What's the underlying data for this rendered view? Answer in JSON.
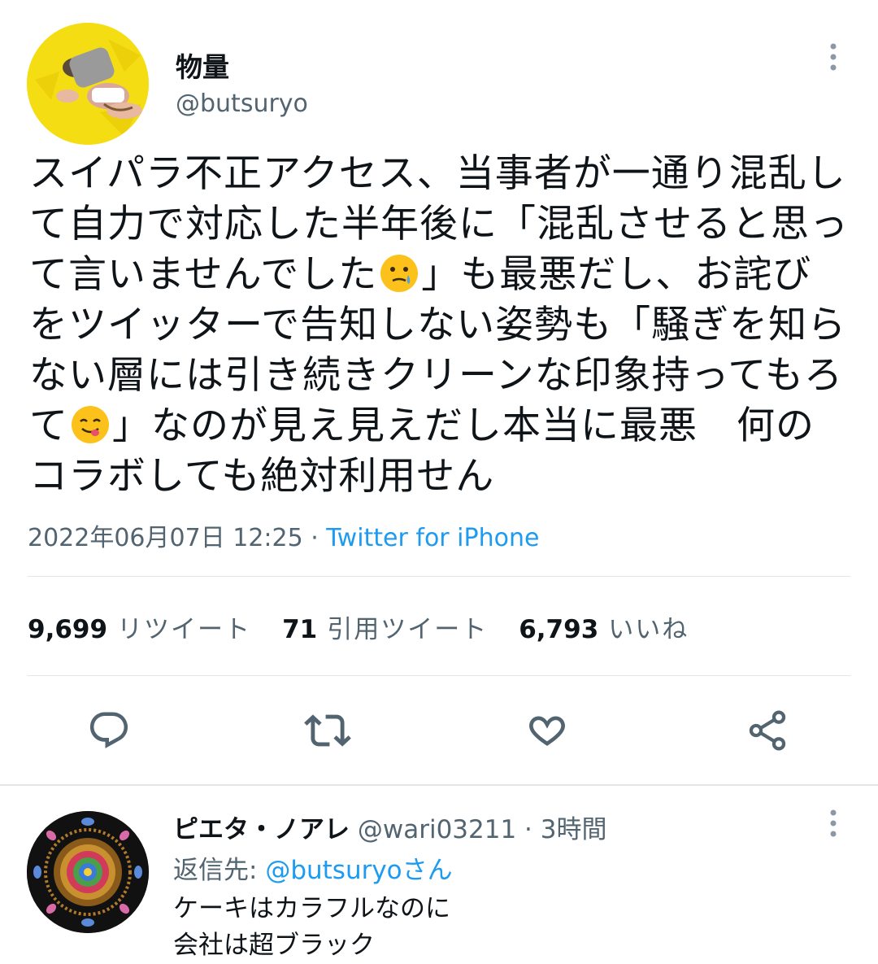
{
  "tweet": {
    "author_name": "物量",
    "author_handle": "@butsuryo",
    "text_part1": "スイパラ不正アクセス、当事者が一通り混乱して自力で対応した半年後に「混乱させると思って言いませんでした",
    "text_part2": "」も最悪だし、お詫びをツイッターで告知しない姿勢も「騒ぎを知らない層には引き続きクリーンな印象持ってもろて",
    "text_part3": "」なのが見え見えだし本当に最悪　何のコラボしても絶対利用せん",
    "emoji1": "face-holding-back-tears-icon",
    "emoji2": "face-savoring-food-icon",
    "timestamp": "2022年06月07日 12:25 · ",
    "source": "Twitter for iPhone"
  },
  "stats": {
    "retweets_count": "9,699",
    "retweets_label": "リツイート",
    "quotes_count": "71",
    "quotes_label": "引用ツイート",
    "likes_count": "6,793",
    "likes_label": "いいね"
  },
  "actions": [
    "reply-icon",
    "retweet-icon",
    "like-icon",
    "share-icon"
  ],
  "reply": {
    "author_name": "ピエタ・ノアレ",
    "author_handle": "@wari03211",
    "time": " · 3時間",
    "replying_prefix": "返信先: ",
    "replying_mention": "@butsuryo",
    "replying_suffix": "さん",
    "text": "ケーキはカラフルなのに\n会社は超ブラック"
  },
  "colors": {
    "accent": "#1d9bf0",
    "secondary_text": "#536471",
    "avatar_bg": "#f5dd14"
  }
}
